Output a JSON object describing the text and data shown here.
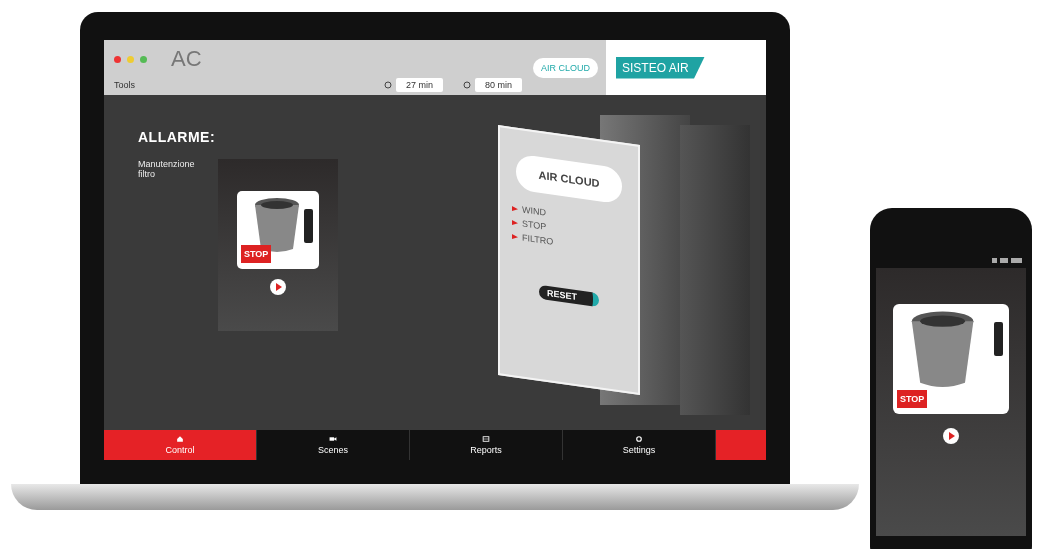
{
  "laptop": {
    "header": {
      "title": "AC",
      "menu": "Tools",
      "timers": [
        "27 min",
        "80 min"
      ],
      "cloud_badge": "AIR CLOUD",
      "brand": "SISTEO AIR"
    },
    "alarm": {
      "title": "ALLARME:",
      "message": "Manutenzione filtro",
      "device_badge": "STOP"
    },
    "panel": {
      "title": "AIR CLOUD",
      "items": [
        "WIND",
        "STOP",
        "FILTRO"
      ],
      "button": "RESET"
    },
    "nav": [
      {
        "label": "Control",
        "selected": true
      },
      {
        "label": "Scenes",
        "selected": false
      },
      {
        "label": "Reports",
        "selected": false
      },
      {
        "label": "Settings",
        "selected": false
      }
    ]
  },
  "phone": {
    "device_badge": "STOP"
  }
}
